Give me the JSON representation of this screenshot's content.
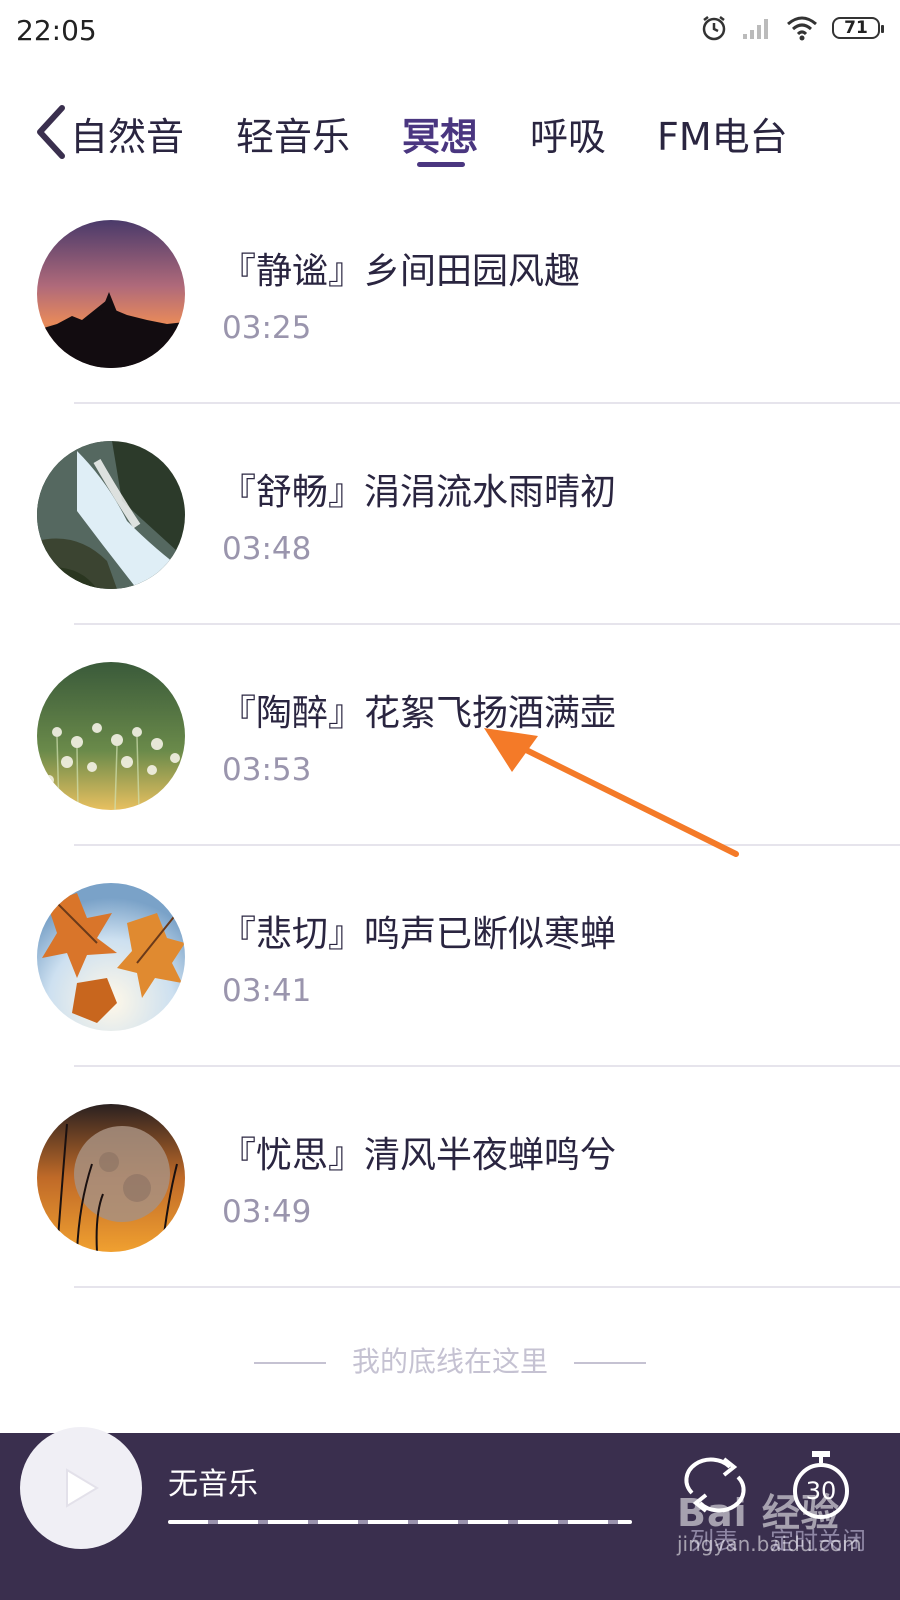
{
  "status_bar": {
    "time": "22:05",
    "battery": "71",
    "icons": [
      "alarm-icon",
      "signal-icon",
      "wifi-icon",
      "battery-icon"
    ]
  },
  "tabs": {
    "back_icon": "chevron-left-icon",
    "items": [
      {
        "label": "自然音",
        "active": false
      },
      {
        "label": "轻音乐",
        "active": false
      },
      {
        "label": "冥想",
        "active": true
      },
      {
        "label": "呼吸",
        "active": false
      },
      {
        "label": "FM电台",
        "active": false
      }
    ]
  },
  "tracks": [
    {
      "title": "『静谧』乡间田园风趣",
      "duration": "03:25",
      "cover": "sunset-forest"
    },
    {
      "title": "『舒畅』涓涓流水雨晴初",
      "duration": "03:48",
      "cover": "waterfall"
    },
    {
      "title": "『陶醉』花絮飞扬酒满壶",
      "duration": "03:53",
      "cover": "dandelion-field"
    },
    {
      "title": "『悲切』鸣声已断似寒蝉",
      "duration": "03:41",
      "cover": "autumn-leaves"
    },
    {
      "title": "『忧思』清风半夜蝉鸣兮",
      "duration": "03:49",
      "cover": "moon-grass"
    }
  ],
  "end_text": "我的底线在这里",
  "player": {
    "now_playing": "无音乐",
    "list_label": "列表",
    "timer_label": "定时关闭",
    "timer_value": "30",
    "colors": {
      "background": "#3a2f4e",
      "accent": "#4a3680"
    }
  },
  "watermark": {
    "logo": "Bai 经验",
    "url": "jingyan.baidu.com"
  }
}
